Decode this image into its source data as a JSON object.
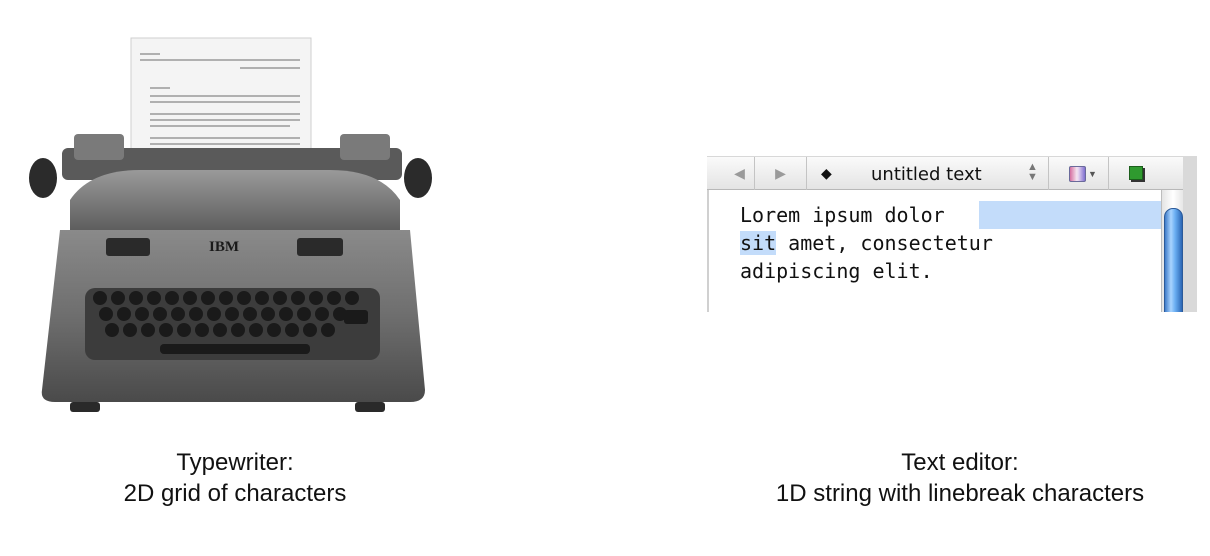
{
  "typewriter": {
    "brand": "IBM",
    "caption_line1": "Typewriter:",
    "caption_line2": "2D grid of characters"
  },
  "editor": {
    "back_icon": "triangle-left-icon",
    "forward_icon": "triangle-right-icon",
    "document_title": "untitled text",
    "line1": "Lorem ipsum dolor ",
    "line2_selected": "sit",
    "line2_rest": " amet, consectetur",
    "line3": "adipiscing elit.",
    "selection_color": "#c3dcfa"
  },
  "caption_right": {
    "line1": "Text editor:",
    "line2": "1D string with linebreak characters"
  }
}
